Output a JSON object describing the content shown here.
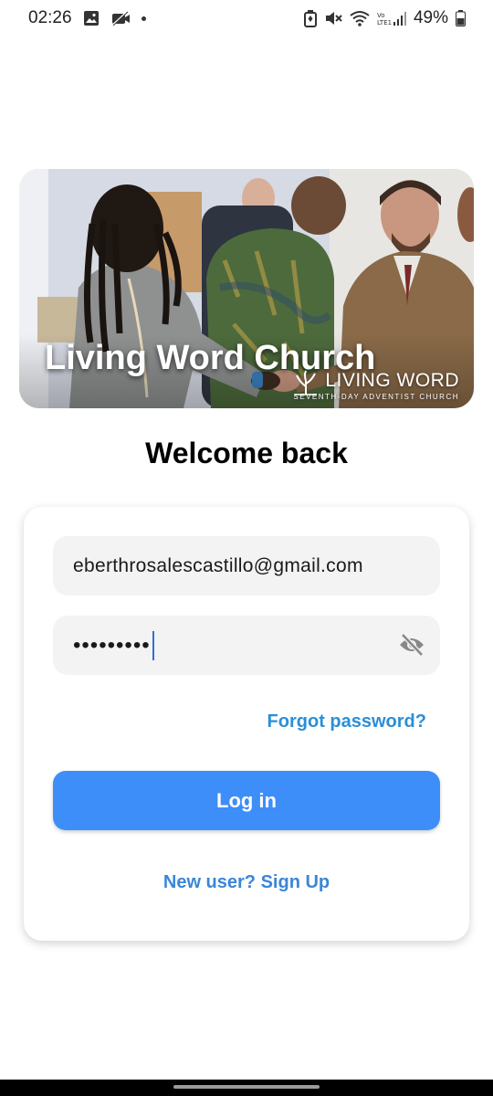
{
  "status_bar": {
    "time": "02:26",
    "battery": "49%",
    "icons": [
      "image-icon",
      "camera-off-icon",
      "notification-dot",
      "battery-saver-icon",
      "mute-icon",
      "wifi-icon",
      "volte-signal-icon",
      "battery-icon"
    ]
  },
  "hero": {
    "title": "Living Word Church",
    "logo_main": "LIVING WORD",
    "logo_sub": "SEVENTH-DAY ADVENTIST CHURCH"
  },
  "welcome": "Welcome back",
  "form": {
    "email_value": "eberthrosalescastillo@gmail.com",
    "password_mask": "•••••••••",
    "password_visibility_icon": "eye-off-icon",
    "forgot_label": "Forgot password?",
    "login_label": "Log in",
    "signup_label": "New user? Sign Up"
  },
  "colors": {
    "accent": "#3d8ef8",
    "link": "#2a8fd8",
    "field_bg": "#f3f3f4"
  }
}
